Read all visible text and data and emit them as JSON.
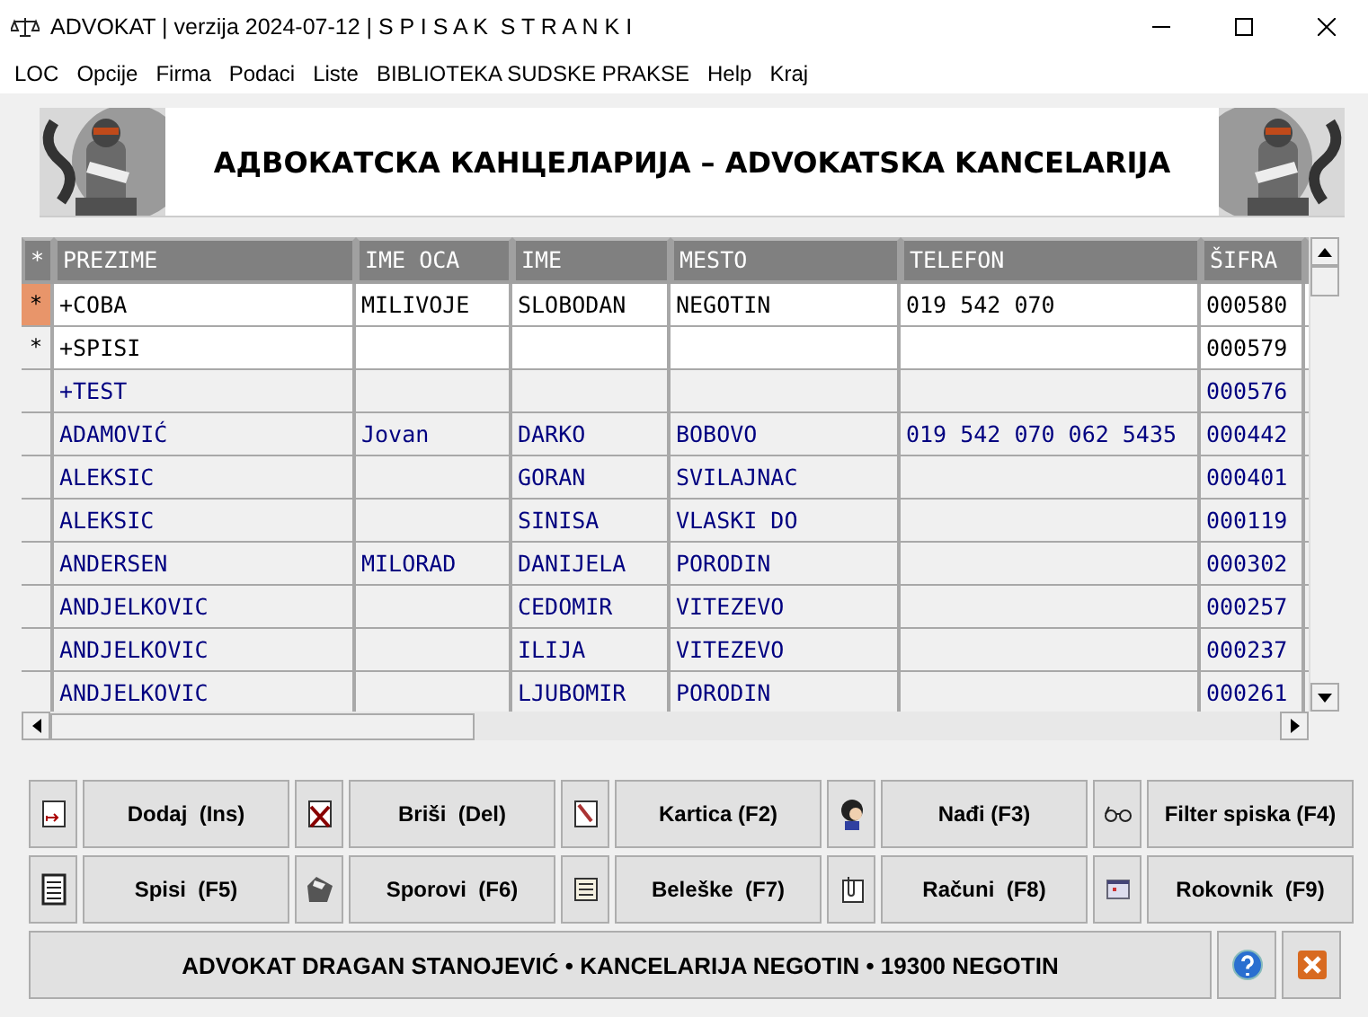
{
  "window": {
    "title": "ADVOKAT | verzija 2024-07-12 | S P I S A K  S T R A N K I"
  },
  "menu": [
    "LOC",
    "Opcije",
    "Firma",
    "Podaci",
    "Liste",
    "BIBLIOTEKA SUDSKE PRAKSE",
    "Help",
    "Kraj"
  ],
  "banner": {
    "title": "АДВОКАТСКА КАНЦЕЛАРИЈА – ADVOKATSKA KANCELARIJA"
  },
  "table": {
    "marker_header": "*",
    "columns": [
      "PREZIME",
      "IME OCA",
      "IME",
      "MESTO",
      "TELEFON",
      "ŠIFRA"
    ],
    "rows": [
      {
        "marker": "*",
        "current": true,
        "highlighted": true,
        "cells": [
          "+COBA",
          "MILIVOJE",
          "SLOBODAN",
          "NEGOTIN",
          "019 542 070",
          "000580"
        ]
      },
      {
        "marker": "*",
        "current": false,
        "highlighted": true,
        "cells": [
          "+SPISI",
          "",
          "",
          "",
          "",
          "000579"
        ]
      },
      {
        "current": false,
        "highlighted": false,
        "cells": [
          "+TEST",
          "",
          "",
          "",
          "",
          "000576"
        ]
      },
      {
        "current": false,
        "highlighted": false,
        "cells": [
          "ADAMOVIĆ",
          "Jovan",
          "DARKO",
          "BOBOVO",
          "019 542 070 062 5435",
          "000442"
        ]
      },
      {
        "current": false,
        "highlighted": false,
        "cells": [
          "ALEKSIC",
          "",
          "GORAN",
          "SVILAJNAC",
          "",
          "000401"
        ]
      },
      {
        "current": false,
        "highlighted": false,
        "cells": [
          "ALEKSIC",
          "",
          "SINISA",
          "VLASKI DO",
          "",
          "000119"
        ]
      },
      {
        "current": false,
        "highlighted": false,
        "cells": [
          "ANDERSEN",
          "MILORAD",
          "DANIJELA",
          "PORODIN",
          "",
          "000302"
        ]
      },
      {
        "current": false,
        "highlighted": false,
        "cells": [
          "ANDJELKOVIC",
          "",
          "CEDOMIR",
          "VITEZEVO",
          "",
          "000257"
        ]
      },
      {
        "current": false,
        "highlighted": false,
        "cells": [
          "ANDJELKOVIC",
          "",
          "ILIJA",
          "VITEZEVO",
          "",
          "000237"
        ]
      },
      {
        "current": false,
        "highlighted": false,
        "cells": [
          "ANDJELKOVIC",
          "",
          "LJUBOMIR",
          "PORODIN",
          "",
          "000261"
        ]
      }
    ]
  },
  "actions": [
    {
      "label": "Dodaj  (Ins)"
    },
    {
      "label": "Briši  (Del)"
    },
    {
      "label": "Kartica (F2)"
    },
    {
      "label": "Nađi (F3)"
    },
    {
      "label": "Filter spiska (F4)"
    },
    {
      "label": "Spisi  (F5)"
    },
    {
      "label": "Sporovi  (F6)"
    },
    {
      "label": "Beleške  (F7)"
    },
    {
      "label": "Računi  (F8)"
    },
    {
      "label": "Rokovnik  (F9)"
    }
  ],
  "status_bar": {
    "text": "ADVOKAT DRAGAN STANOJEVIĆ • KANCELARIJA NEGOTIN • 19300 NEGOTIN"
  }
}
